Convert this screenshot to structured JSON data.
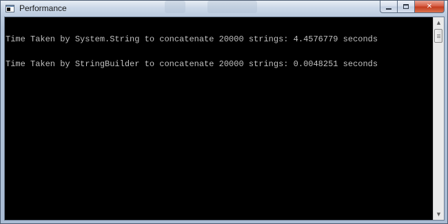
{
  "window": {
    "title": "Performance",
    "icon": "console-icon"
  },
  "caption_buttons": {
    "minimize_icon": "minimize-icon",
    "maximize_icon": "maximize-icon",
    "close_icon": "close-icon",
    "close_glyph": "✕"
  },
  "console": {
    "lines": [
      "Time Taken by System.String to concatenate 20000 strings: 4.4576779 seconds",
      "Time Taken by StringBuilder to concatenate 20000 strings: 0.0048251 seconds"
    ]
  },
  "scrollbar": {
    "up_glyph": "▲",
    "down_glyph": "▼"
  },
  "colors": {
    "console_background": "#000000",
    "console_text": "#c0c0c0",
    "close_button": "#c2391c"
  }
}
